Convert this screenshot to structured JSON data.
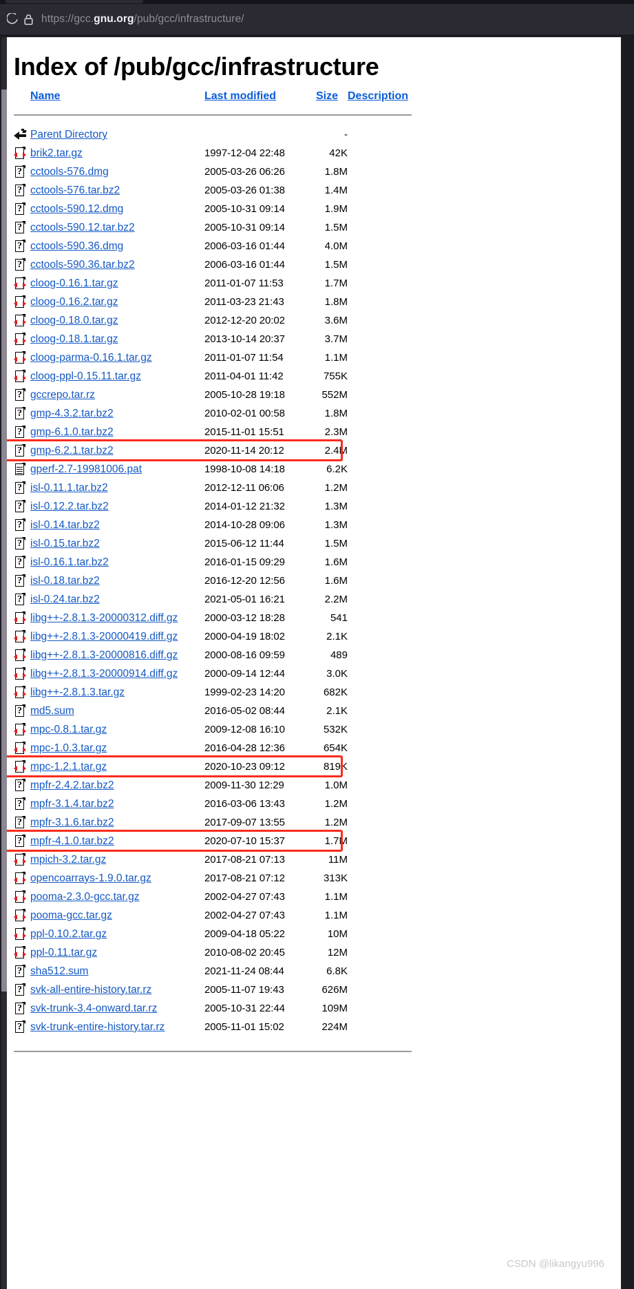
{
  "browser": {
    "url_scheme": "https://gcc.",
    "url_host": "gnu.org",
    "url_path": "/pub/gcc/infrastructure/",
    "lock_icon": "lock-icon",
    "back_icon": "back-arrow-icon"
  },
  "page": {
    "title": "Index of /pub/gcc/infrastructure",
    "watermark": "CSDN @likangyu996"
  },
  "table": {
    "headers": {
      "name": "Name",
      "last_modified": "Last modified",
      "size": "Size",
      "description": "Description"
    },
    "rows": [
      {
        "icon": "back",
        "name": "Parent Directory",
        "modified": "",
        "size": "-",
        "desc": "",
        "highlight": false
      },
      {
        "icon": "gz",
        "name": "brik2.tar.gz",
        "modified": "1997-12-04 22:48",
        "size": "42K",
        "desc": "",
        "highlight": false
      },
      {
        "icon": "unknown",
        "name": "cctools-576.dmg",
        "modified": "2005-03-26 06:26",
        "size": "1.8M",
        "desc": "",
        "highlight": false
      },
      {
        "icon": "unknown",
        "name": "cctools-576.tar.bz2",
        "modified": "2005-03-26 01:38",
        "size": "1.4M",
        "desc": "",
        "highlight": false
      },
      {
        "icon": "unknown",
        "name": "cctools-590.12.dmg",
        "modified": "2005-10-31 09:14",
        "size": "1.9M",
        "desc": "",
        "highlight": false
      },
      {
        "icon": "unknown",
        "name": "cctools-590.12.tar.bz2",
        "modified": "2005-10-31 09:14",
        "size": "1.5M",
        "desc": "",
        "highlight": false
      },
      {
        "icon": "unknown",
        "name": "cctools-590.36.dmg",
        "modified": "2006-03-16 01:44",
        "size": "4.0M",
        "desc": "",
        "highlight": false
      },
      {
        "icon": "unknown",
        "name": "cctools-590.36.tar.bz2",
        "modified": "2006-03-16 01:44",
        "size": "1.5M",
        "desc": "",
        "highlight": false
      },
      {
        "icon": "gz",
        "name": "cloog-0.16.1.tar.gz",
        "modified": "2011-01-07 11:53",
        "size": "1.7M",
        "desc": "",
        "highlight": false
      },
      {
        "icon": "gz",
        "name": "cloog-0.16.2.tar.gz",
        "modified": "2011-03-23 21:43",
        "size": "1.8M",
        "desc": "",
        "highlight": false
      },
      {
        "icon": "gz",
        "name": "cloog-0.18.0.tar.gz",
        "modified": "2012-12-20 20:02",
        "size": "3.6M",
        "desc": "",
        "highlight": false
      },
      {
        "icon": "gz",
        "name": "cloog-0.18.1.tar.gz",
        "modified": "2013-10-14 20:37",
        "size": "3.7M",
        "desc": "",
        "highlight": false
      },
      {
        "icon": "gz",
        "name": "cloog-parma-0.16.1.tar.gz",
        "modified": "2011-01-07 11:54",
        "size": "1.1M",
        "desc": "",
        "highlight": false
      },
      {
        "icon": "gz",
        "name": "cloog-ppl-0.15.11.tar.gz",
        "modified": "2011-04-01 11:42",
        "size": "755K",
        "desc": "",
        "highlight": false
      },
      {
        "icon": "unknown",
        "name": "gccrepo.tar.rz",
        "modified": "2005-10-28 19:18",
        "size": "552M",
        "desc": "",
        "highlight": false
      },
      {
        "icon": "unknown",
        "name": "gmp-4.3.2.tar.bz2",
        "modified": "2010-02-01 00:58",
        "size": "1.8M",
        "desc": "",
        "highlight": false
      },
      {
        "icon": "unknown",
        "name": "gmp-6.1.0.tar.bz2",
        "modified": "2015-11-01 15:51",
        "size": "2.3M",
        "desc": "",
        "highlight": false
      },
      {
        "icon": "unknown",
        "name": "gmp-6.2.1.tar.bz2",
        "modified": "2020-11-14 20:12",
        "size": "2.4M",
        "desc": "",
        "highlight": true
      },
      {
        "icon": "text",
        "name": "gperf-2.7-19981006.pat",
        "modified": "1998-10-08 14:18",
        "size": "6.2K",
        "desc": "",
        "highlight": false
      },
      {
        "icon": "unknown",
        "name": "isl-0.11.1.tar.bz2",
        "modified": "2012-12-11 06:06",
        "size": "1.2M",
        "desc": "",
        "highlight": false
      },
      {
        "icon": "unknown",
        "name": "isl-0.12.2.tar.bz2",
        "modified": "2014-01-12 21:32",
        "size": "1.3M",
        "desc": "",
        "highlight": false
      },
      {
        "icon": "unknown",
        "name": "isl-0.14.tar.bz2",
        "modified": "2014-10-28 09:06",
        "size": "1.3M",
        "desc": "",
        "highlight": false
      },
      {
        "icon": "unknown",
        "name": "isl-0.15.tar.bz2",
        "modified": "2015-06-12 11:44",
        "size": "1.5M",
        "desc": "",
        "highlight": false
      },
      {
        "icon": "unknown",
        "name": "isl-0.16.1.tar.bz2",
        "modified": "2016-01-15 09:29",
        "size": "1.6M",
        "desc": "",
        "highlight": false
      },
      {
        "icon": "unknown",
        "name": "isl-0.18.tar.bz2",
        "modified": "2016-12-20 12:56",
        "size": "1.6M",
        "desc": "",
        "highlight": false
      },
      {
        "icon": "unknown",
        "name": "isl-0.24.tar.bz2",
        "modified": "2021-05-01 16:21",
        "size": "2.2M",
        "desc": "",
        "highlight": false
      },
      {
        "icon": "gz",
        "name": "libg++-2.8.1.3-20000312.diff.gz",
        "modified": "2000-03-12 18:28",
        "size": "541",
        "desc": "",
        "highlight": false
      },
      {
        "icon": "gz",
        "name": "libg++-2.8.1.3-20000419.diff.gz",
        "modified": "2000-04-19 18:02",
        "size": "2.1K",
        "desc": "",
        "highlight": false
      },
      {
        "icon": "gz",
        "name": "libg++-2.8.1.3-20000816.diff.gz",
        "modified": "2000-08-16 09:59",
        "size": "489",
        "desc": "",
        "highlight": false
      },
      {
        "icon": "gz",
        "name": "libg++-2.8.1.3-20000914.diff.gz",
        "modified": "2000-09-14 12:44",
        "size": "3.0K",
        "desc": "",
        "highlight": false
      },
      {
        "icon": "gz",
        "name": "libg++-2.8.1.3.tar.gz",
        "modified": "1999-02-23 14:20",
        "size": "682K",
        "desc": "",
        "highlight": false
      },
      {
        "icon": "unknown",
        "name": "md5.sum",
        "modified": "2016-05-02 08:44",
        "size": "2.1K",
        "desc": "",
        "highlight": false
      },
      {
        "icon": "gz",
        "name": "mpc-0.8.1.tar.gz",
        "modified": "2009-12-08 16:10",
        "size": "532K",
        "desc": "",
        "highlight": false
      },
      {
        "icon": "gz",
        "name": "mpc-1.0.3.tar.gz",
        "modified": "2016-04-28 12:36",
        "size": "654K",
        "desc": "",
        "highlight": false
      },
      {
        "icon": "gz",
        "name": "mpc-1.2.1.tar.gz",
        "modified": "2020-10-23 09:12",
        "size": "819K",
        "desc": "",
        "highlight": true
      },
      {
        "icon": "unknown",
        "name": "mpfr-2.4.2.tar.bz2",
        "modified": "2009-11-30 12:29",
        "size": "1.0M",
        "desc": "",
        "highlight": false
      },
      {
        "icon": "unknown",
        "name": "mpfr-3.1.4.tar.bz2",
        "modified": "2016-03-06 13:43",
        "size": "1.2M",
        "desc": "",
        "highlight": false
      },
      {
        "icon": "unknown",
        "name": "mpfr-3.1.6.tar.bz2",
        "modified": "2017-09-07 13:55",
        "size": "1.2M",
        "desc": "",
        "highlight": false
      },
      {
        "icon": "unknown",
        "name": "mpfr-4.1.0.tar.bz2",
        "modified": "2020-07-10 15:37",
        "size": "1.7M",
        "desc": "",
        "highlight": true
      },
      {
        "icon": "gz",
        "name": "mpich-3.2.tar.gz",
        "modified": "2017-08-21 07:13",
        "size": "11M",
        "desc": "",
        "highlight": false
      },
      {
        "icon": "gz",
        "name": "opencoarrays-1.9.0.tar.gz",
        "modified": "2017-08-21 07:12",
        "size": "313K",
        "desc": "",
        "highlight": false
      },
      {
        "icon": "gz",
        "name": "pooma-2.3.0-gcc.tar.gz",
        "modified": "2002-04-27 07:43",
        "size": "1.1M",
        "desc": "",
        "highlight": false
      },
      {
        "icon": "gz",
        "name": "pooma-gcc.tar.gz",
        "modified": "2002-04-27 07:43",
        "size": "1.1M",
        "desc": "",
        "highlight": false
      },
      {
        "icon": "gz",
        "name": "ppl-0.10.2.tar.gz",
        "modified": "2009-04-18 05:22",
        "size": "10M",
        "desc": "",
        "highlight": false
      },
      {
        "icon": "gz",
        "name": "ppl-0.11.tar.gz",
        "modified": "2010-08-02 20:45",
        "size": "12M",
        "desc": "",
        "highlight": false
      },
      {
        "icon": "unknown",
        "name": "sha512.sum",
        "modified": "2021-11-24 08:44",
        "size": "6.8K",
        "desc": "",
        "highlight": false
      },
      {
        "icon": "unknown",
        "name": "svk-all-entire-history.tar.rz",
        "modified": "2005-11-07 19:43",
        "size": "626M",
        "desc": "",
        "highlight": false
      },
      {
        "icon": "unknown",
        "name": "svk-trunk-3.4-onward.tar.rz",
        "modified": "2005-10-31 22:44",
        "size": "109M",
        "desc": "",
        "highlight": false
      },
      {
        "icon": "unknown",
        "name": "svk-trunk-entire-history.tar.rz",
        "modified": "2005-11-01 15:02",
        "size": "224M",
        "desc": "",
        "highlight": false
      }
    ]
  },
  "colors": {
    "link": "#1459c4",
    "header_link": "#0b5dd7",
    "highlight": "#fb2b1c",
    "chrome_bg": "#2b2a33"
  }
}
